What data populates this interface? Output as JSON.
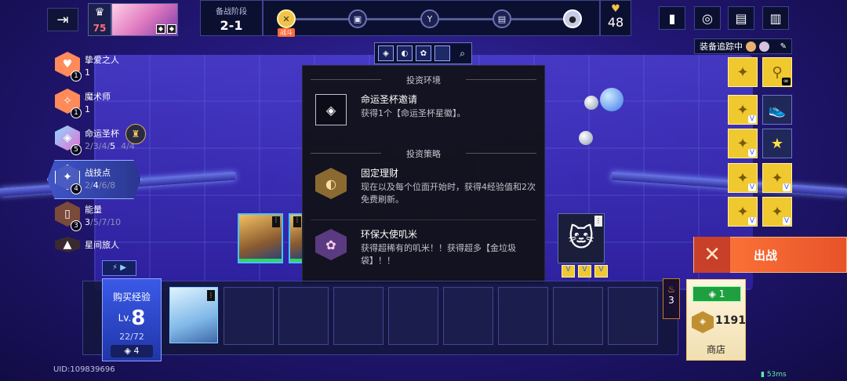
{
  "player": {
    "level": "75"
  },
  "stage": {
    "label": "备战阶段",
    "value": "2-1",
    "current_tag": "战斗"
  },
  "health": "48",
  "equipment_tracking": {
    "title": "装备追踪中",
    "infinity": "∞"
  },
  "synergies": [
    {
      "name": "挚爱之人",
      "count": "1",
      "tiers_text": "1",
      "active": "1"
    },
    {
      "name": "魔术师",
      "count": "1",
      "tiers_text": "1",
      "active": "1"
    },
    {
      "name": "命运圣杯",
      "count": "5",
      "tiers": [
        "2",
        "3",
        "4",
        "5"
      ],
      "active": "5",
      "extra": "4/4"
    },
    {
      "name": "战技点",
      "count": "4",
      "tiers": [
        "2",
        "4",
        "6",
        "8"
      ],
      "active": "4"
    },
    {
      "name": "能量",
      "count": "3",
      "tiers": [
        "3",
        "5",
        "7",
        "10"
      ],
      "active": "3"
    },
    {
      "name": "星间旅人",
      "count": ""
    }
  ],
  "popup": {
    "section1": "投资环境",
    "env_title": "命运圣杯邀请",
    "env_desc": "获得1个【命运圣杯星徽】。",
    "section2": "投资策略",
    "s1_title": "固定理财",
    "s1_desc": "现在以及每个位面开始时，获得4经验值和2次免费刷新。",
    "s2_title": "环保大使叽米",
    "s2_desc": "获得超稀有的叽米！！获得超多【金垃圾袋】！！"
  },
  "exp": {
    "title": "购买经验",
    "lv_prefix": "Lv.",
    "level": "8",
    "progress": "22/72",
    "cost": "4"
  },
  "streak": "3",
  "shop": {
    "reroll_cost": "1",
    "gold": "1191",
    "label": "商店"
  },
  "fight_label": "出战",
  "uid": "UID:109839696",
  "ping": "53ms"
}
